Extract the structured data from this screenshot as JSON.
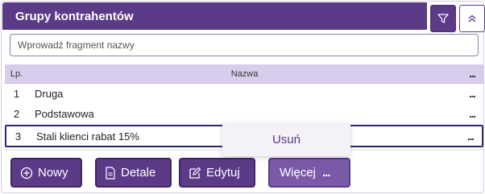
{
  "header": {
    "title": "Grupy kontrahentów"
  },
  "search": {
    "placeholder": "Wprowadź fragment nazwy"
  },
  "table": {
    "columns": [
      "Lp.",
      "Nazwa",
      "..."
    ],
    "rows": [
      {
        "lp": "1",
        "name": "Druga",
        "more": "..."
      },
      {
        "lp": "2",
        "name": "Podstawowa",
        "more": "..."
      },
      {
        "lp": "3",
        "name": "Stali klienci rabat 15%",
        "more": "..."
      }
    ]
  },
  "context_menu": {
    "items": [
      "Usuń"
    ]
  },
  "buttons": {
    "new": "Nowy",
    "details": "Detale",
    "edit": "Edytuj",
    "more": "Więcej",
    "more_icon": "..."
  },
  "colors": {
    "primary": "#5b3a87",
    "header_row": "#d9cdee",
    "selected_border": "#2b2873"
  }
}
